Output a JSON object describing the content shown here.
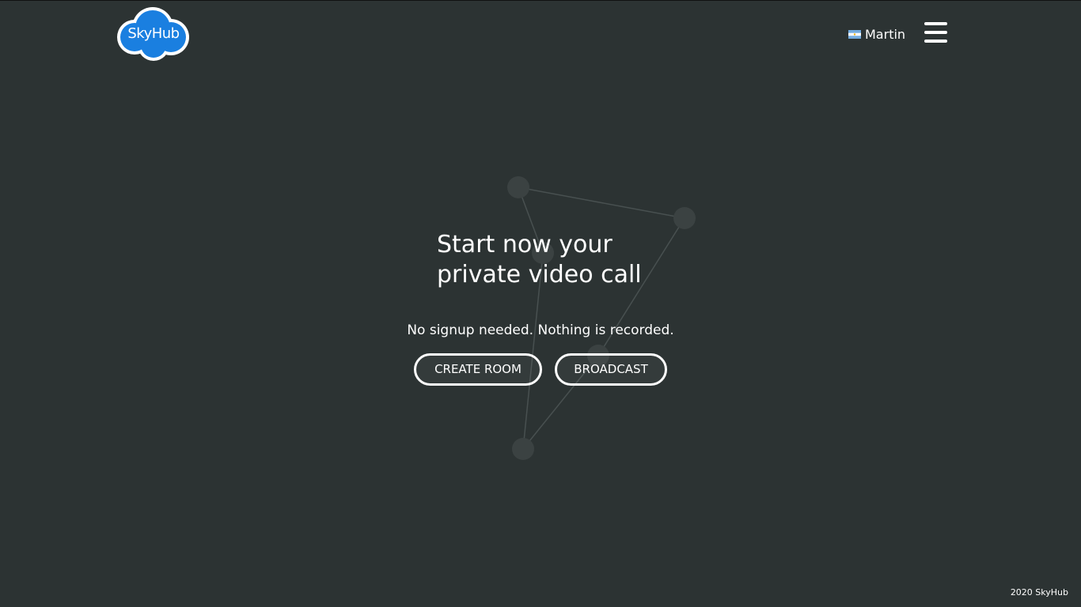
{
  "header": {
    "logo_text": "SkyHub",
    "user": {
      "name": "Martin",
      "flag_icon": "argentina-flag-icon"
    },
    "menu_icon": "hamburger-menu-icon"
  },
  "hero": {
    "headline_line1": "Start now your",
    "headline_line2": "private video call",
    "subtitle": "No signup needed. Nothing is recorded.",
    "create_room_label": "CREATE ROOM",
    "broadcast_label": "BROADCAST"
  },
  "footer": {
    "copyright": "2020 SkyHub"
  },
  "colors": {
    "background": "#2c3333",
    "logo_blue": "#1a7fe0",
    "text": "#ffffff",
    "network_node": "#3b4242",
    "network_line": "#4a5252"
  }
}
